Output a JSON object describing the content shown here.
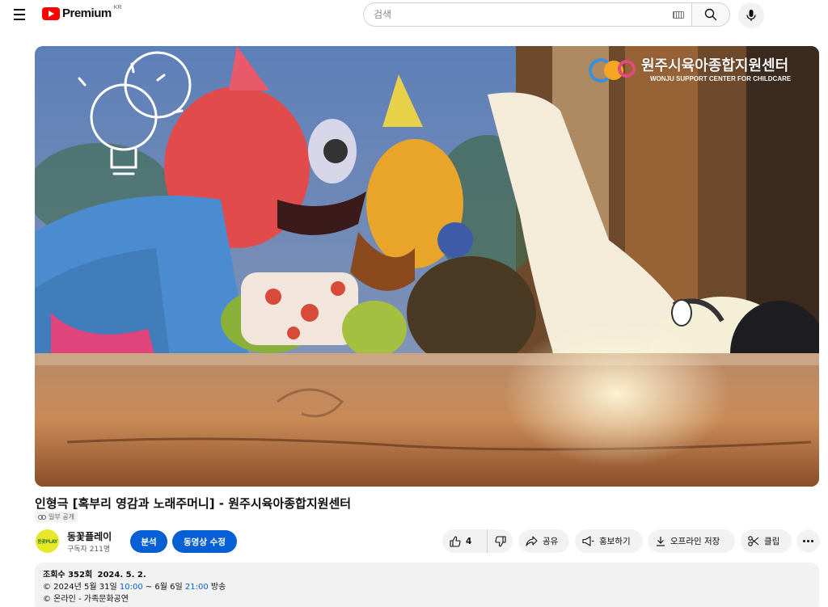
{
  "header": {
    "logo_text": "Premium",
    "logo_region": "KR",
    "search_placeholder": "검색"
  },
  "video": {
    "title": "인형극 [혹부리 영감과 노래주머니] - 원주시육아종합지원센터",
    "visibility": "일부 공개",
    "overlay_org_name": "원주시육아종합지원센터",
    "overlay_org_english": "WONJU SUPPORT CENTER FOR CHILDCARE"
  },
  "channel": {
    "name": "동꽃플레이",
    "subscribers": "구독자 211명",
    "avatar_text": "동꽃PLAY"
  },
  "buttons": {
    "analytics": "분석",
    "edit_video": "동영상 수정",
    "like_count": "4",
    "share": "공유",
    "promote": "홍보하기",
    "download": "오프라인 저장",
    "clip": "클립"
  },
  "description": {
    "views": "조회수 352회",
    "date": "2024. 5. 2.",
    "schedule_prefix": "© 2024년 5월 31일 ",
    "schedule_time1": "10:00",
    "schedule_mid": " ~ 6월 6일 ",
    "schedule_time2": "21:00",
    "schedule_suffix": " 방송",
    "category": "© 온라인 - 가족문화공연"
  },
  "colors": {
    "brand_red": "#ff0000",
    "accent_blue": "#065fd4",
    "pill_bg": "#f2f2f2"
  }
}
